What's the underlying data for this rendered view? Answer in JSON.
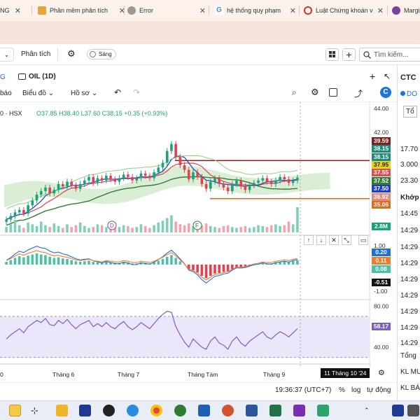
{
  "browser": {
    "tabs": [
      {
        "label": "NG",
        "icon_color": "#c42b1c"
      },
      {
        "label": "Phần mềm phân tích",
        "icon_color": "#e8a33b"
      },
      {
        "label": "Error",
        "icon_color": "#888888"
      },
      {
        "label": "hệ thống quy phạm",
        "icon_color": "#4285f4"
      },
      {
        "label": "Luật Chứng khoán v",
        "icon_color": "#d93025"
      },
      {
        "label": "Margi",
        "icon_color": "#7b3fa0"
      }
    ]
  },
  "app_toolbar": {
    "analysis_label": "Phân tích",
    "theme_label": "Sáng",
    "search_placeholder": "Tìm kiếm..."
  },
  "chart_header": {
    "symbol_tab": "OIL (1D)",
    "report_label": "báo",
    "chart_menu": "Biểu đồ",
    "profile_menu": "Hồ sơ",
    "exchange": "0 · HSX",
    "ohlc": {
      "o": "O37.85",
      "h": "H38.40",
      "l": "L37.60",
      "c": "C38.15",
      "chg": "+0.35 (+0.93%)"
    }
  },
  "price_axis": [
    "44.00",
    "42.00",
    "40.00",
    "38.00",
    "36.00",
    "34.00"
  ],
  "price_tags": [
    {
      "v": "39.59",
      "bg": "#7b1f1f"
    },
    {
      "v": "38.15",
      "bg": "#1a8c78"
    },
    {
      "v": "38.15",
      "bg": "#1a8c78"
    },
    {
      "v": "37.95",
      "bg": "#e6d31c",
      "fg": "#222"
    },
    {
      "v": "37.55",
      "bg": "#e05050"
    },
    {
      "v": "37.52",
      "bg": "#2e7d32"
    },
    {
      "v": "37.50",
      "bg": "#1e3fc4"
    },
    {
      "v": "36.92",
      "bg": "#e08a7a"
    },
    {
      "v": "35.06",
      "bg": "#e06a1a"
    }
  ],
  "volume_tag": "2.8M",
  "macd_axis": [
    "1.00",
    "0.20",
    "0.11",
    "0.08",
    "-0.51",
    "-1.00"
  ],
  "macd_tags": [
    {
      "v": "0.20",
      "bg": "#1e6fd8"
    },
    {
      "v": "0.11",
      "bg": "#f07b2a"
    },
    {
      "v": "0.08",
      "bg": "#4cc0a8"
    },
    {
      "v": "-0.51",
      "bg": "#111111"
    }
  ],
  "rsi_axis": [
    "80.00",
    "58.17",
    "40.00"
  ],
  "rsi_tag": "58.17",
  "x_labels": [
    "Tháng 6",
    "Tháng 7",
    "Tháng Tám",
    "Tháng 9"
  ],
  "x_cursor": "11 Tháng 10 '24",
  "markers": [
    "D",
    "F"
  ],
  "status": {
    "clock": "19:36:37 (UTC+7)",
    "pct": "%",
    "log": "log",
    "auto": "tự động"
  },
  "right_panel": {
    "title": "CTC",
    "rows": [
      "DO",
      "Tổ",
      "17.70",
      "3.000",
      "23.30",
      "Khớp",
      "14:45",
      "14:29",
      "14:29",
      "14:29",
      "14:29",
      "14:29",
      "14:29",
      "14:29",
      "14:29",
      "Tổng",
      "KL MU",
      "KL BÁ"
    ]
  },
  "colors": {
    "up": "#1aa37a",
    "down": "#e0434f",
    "cloud_green": "#b9e0b0",
    "cloud_red": "#f3c9c0",
    "rsi_band": "#ece6fb",
    "rsi_line": "#7a5fc8"
  },
  "chart_data": {
    "type": "candlestick",
    "note_series": [
      "price",
      "volume",
      "macd",
      "rsi"
    ],
    "closes": [
      34.6,
      34.9,
      35.2,
      35.4,
      35.1,
      35.8,
      36.2,
      36.7,
      37.0,
      37.3,
      36.8,
      37.1,
      37.6,
      37.4,
      37.8,
      37.5,
      37.2,
      37.6,
      37.9,
      38.2,
      37.7,
      38.1,
      37.9,
      38.3,
      38.0,
      37.8,
      38.1,
      38.4,
      38.2,
      37.9,
      38.1,
      38.5,
      38.3,
      38.1,
      38.6,
      39.0,
      39.4,
      40.4,
      41.0,
      39.9,
      39.2,
      38.8,
      38.0,
      38.6,
      38.2,
      37.6,
      37.2,
      37.8,
      38.1,
      37.6,
      37.3,
      37.0,
      37.6,
      37.9,
      37.4,
      37.1,
      37.5,
      37.7,
      37.9,
      38.1,
      37.8,
      37.6,
      37.9,
      38.2,
      38.0,
      37.7,
      37.9,
      38.15
    ],
    "rsi": [
      48,
      52,
      55,
      58,
      54,
      60,
      63,
      66,
      64,
      68,
      62,
      61,
      66,
      63,
      67,
      62,
      58,
      62,
      64,
      66,
      60,
      63,
      60,
      64,
      60,
      58,
      62,
      65,
      60,
      57,
      60,
      64,
      61,
      58,
      63,
      68,
      72,
      75,
      74,
      60,
      52,
      45,
      40,
      48,
      44,
      40,
      38,
      46,
      50,
      44,
      42,
      38,
      46,
      50,
      44,
      41,
      46,
      49,
      52,
      55,
      50,
      48,
      52,
      55,
      53,
      50,
      54,
      58
    ],
    "macd_hist": [
      0.05,
      0.08,
      0.12,
      0.15,
      0.13,
      0.16,
      0.18,
      0.2,
      0.18,
      0.17,
      0.14,
      0.12,
      0.13,
      0.11,
      0.1,
      0.08,
      0.06,
      0.05,
      0.06,
      0.07,
      0.05,
      0.04,
      0.03,
      0.05,
      0.04,
      0.03,
      0.03,
      0.05,
      0.04,
      0.02,
      0.02,
      0.04,
      0.03,
      0.02,
      0.04,
      0.07,
      0.1,
      0.14,
      0.17,
      0.12,
      0.06,
      0.0,
      -0.08,
      -0.1,
      -0.14,
      -0.2,
      -0.24,
      -0.2,
      -0.16,
      -0.15,
      -0.13,
      -0.12,
      -0.08,
      -0.05,
      -0.05,
      -0.04,
      -0.02,
      0.0,
      0.01,
      0.03,
      0.02,
      0.02,
      0.04,
      0.05,
      0.06,
      0.05,
      0.07,
      0.08
    ],
    "volume": [
      0.6,
      0.9,
      1.4,
      0.8,
      0.5,
      1.1,
      0.9,
      0.7,
      1.2,
      0.8,
      0.6,
      1.0,
      0.7,
      0.5,
      0.9,
      0.6,
      0.8,
      1.1,
      0.7,
      0.5,
      0.6,
      0.9,
      0.8,
      0.6,
      0.7,
      0.5,
      0.6,
      0.8,
      0.7,
      0.5,
      0.6,
      0.9,
      0.7,
      0.5,
      0.8,
      1.1,
      1.3,
      1.6,
      1.9,
      1.2,
      0.9,
      0.8,
      1.0,
      0.7,
      0.6,
      0.8,
      1.0,
      0.7,
      0.6,
      0.5,
      0.7,
      0.8,
      0.6,
      0.5,
      0.6,
      0.7,
      0.5,
      0.6,
      0.8,
      0.7,
      0.6,
      0.8,
      0.9,
      0.7,
      0.8,
      1.2,
      0.9,
      2.8
    ],
    "ylim": [
      33.5,
      44.3
    ],
    "xlabel": "",
    "ylabel": ""
  }
}
